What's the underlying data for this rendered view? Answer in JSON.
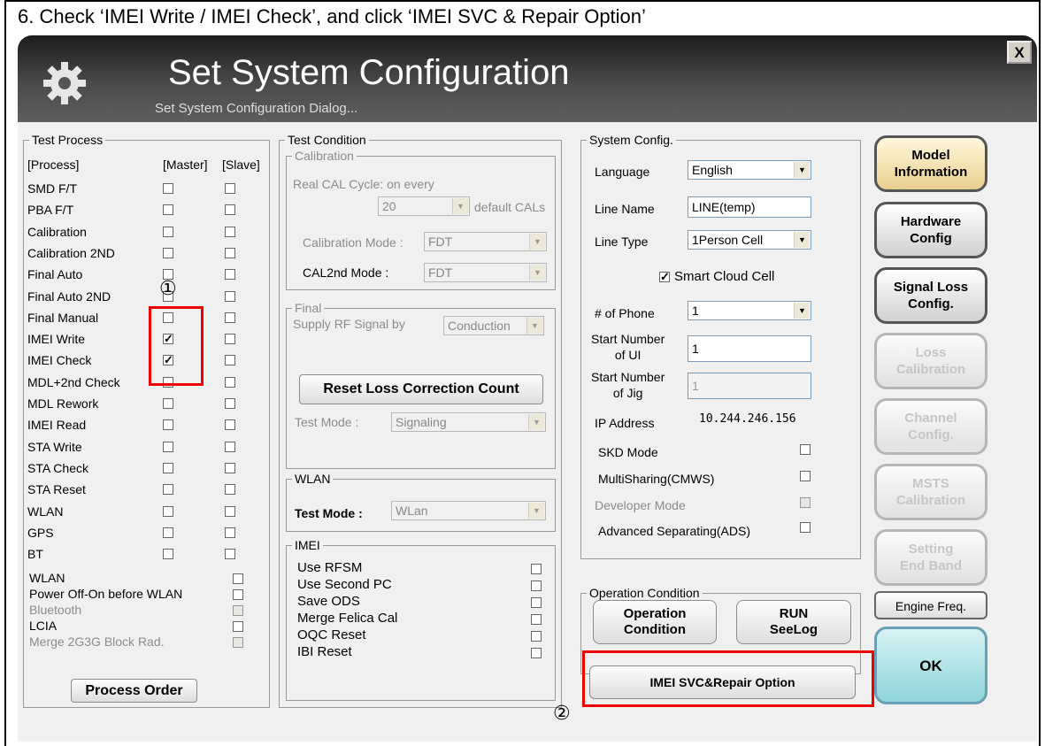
{
  "instruction": "6. Check ‘IMEI Write / IMEI Check’, and click ‘IMEI SVC & Repair Option’",
  "dialog": {
    "title": "Set System Configuration",
    "subtitle": "Set System Configuration Dialog...",
    "close": "X"
  },
  "test_process": {
    "legend": "Test Process",
    "col_process": "[Process]",
    "col_master": "[Master]",
    "col_slave": "[Slave]",
    "items": [
      {
        "label": "SMD F/T",
        "master": false,
        "slave": false
      },
      {
        "label": "PBA F/T",
        "master": false,
        "slave": false
      },
      {
        "label": "Calibration",
        "master": false,
        "slave": false
      },
      {
        "label": "Calibration 2ND",
        "master": false,
        "slave": false
      },
      {
        "label": "Final Auto",
        "master": false,
        "slave": false
      },
      {
        "label": "Final Auto 2ND",
        "master": false,
        "slave": false
      },
      {
        "label": "Final Manual",
        "master": false,
        "slave": false
      },
      {
        "label": "IMEI Write",
        "master": true,
        "slave": false
      },
      {
        "label": "IMEI Check",
        "master": true,
        "slave": false
      },
      {
        "label": "MDL+2nd Check",
        "master": false,
        "slave": false
      },
      {
        "label": "MDL Rework",
        "master": false,
        "slave": false
      },
      {
        "label": "IMEI Read",
        "master": false,
        "slave": false
      },
      {
        "label": "STA Write",
        "master": false,
        "slave": false
      },
      {
        "label": "STA Check",
        "master": false,
        "slave": false
      },
      {
        "label": "STA Reset",
        "master": false,
        "slave": false
      },
      {
        "label": "WLAN",
        "master": false,
        "slave": false
      },
      {
        "label": "GPS",
        "master": false,
        "slave": false
      },
      {
        "label": "BT",
        "master": false,
        "slave": false
      }
    ],
    "options": [
      {
        "label": "WLAN",
        "disabled": false
      },
      {
        "label": "Power Off-On before WLAN",
        "disabled": false
      },
      {
        "label": "Bluetooth",
        "disabled": true
      },
      {
        "label": "LCIA",
        "disabled": false
      },
      {
        "label": "Merge 2G3G Block Rad.",
        "disabled": true
      }
    ],
    "process_order_button": "Process Order"
  },
  "test_condition": {
    "legend": "Test Condition",
    "calibration": {
      "legend": "Calibration",
      "cycle_label": "Real CAL Cycle: on every",
      "cycle_value": "20",
      "cycle_suffix": "default CALs",
      "mode_label": "Calibration Mode :",
      "mode_value": "FDT",
      "cal2_label": "CAL2nd Mode :",
      "cal2_value": "FDT"
    },
    "final": {
      "legend": "Final",
      "supply_label": "Supply RF Signal by",
      "supply_value": "Conduction",
      "reset_button": "Reset Loss Correction Count",
      "test_mode_label": "Test Mode :",
      "test_mode_value": "Signaling"
    },
    "wlan": {
      "legend": "WLAN",
      "test_mode_label": "Test Mode :",
      "test_mode_value": "WLan"
    },
    "imei": {
      "legend": "IMEI",
      "options": [
        "Use RFSM",
        "Use Second PC",
        "Save ODS",
        "Merge Felica Cal",
        "OQC Reset",
        "IBI Reset"
      ]
    }
  },
  "system_config": {
    "legend": "System Config.",
    "language_label": "Language",
    "language_value": "English",
    "line_name_label": "Line Name",
    "line_name_value": "LINE(temp)",
    "line_type_label": "Line Type",
    "line_type_value": "1Person Cell",
    "smart_cloud_label": "Smart Cloud Cell",
    "phone_count_label": "# of Phone",
    "phone_count_value": "1",
    "start_ui_label_1": "Start Number",
    "start_ui_label_2": "of UI",
    "start_ui_value": "1",
    "start_jig_label_1": "Start Number",
    "start_jig_label_2": "of Jig",
    "start_jig_value": "1",
    "ip_label": "IP Address",
    "ip_value": "10.244.246.156",
    "skd_label": "SKD Mode",
    "multisharing_label": "MultiSharing(CMWS)",
    "developer_label": "Developer Mode",
    "ads_label": "Advanced Separating(ADS)"
  },
  "operation_condition": {
    "legend": "Operation Condition",
    "op_button_1": "Operation",
    "op_button_2": "Condition",
    "run_button_1": "RUN",
    "run_button_2": "SeeLog",
    "imei_svc_button": "IMEI SVC&Repair Option"
  },
  "side_buttons": {
    "model_1": "Model",
    "model_2": "Information",
    "hardware_1": "Hardware",
    "hardware_2": "Config",
    "signal_1": "Signal Loss",
    "signal_2": "Config.",
    "loss_1": "Loss",
    "loss_2": "Calibration",
    "channel_1": "Channel",
    "channel_2": "Config.",
    "msts_1": "MSTS",
    "msts_2": "Calibration",
    "setting_1": "Setting",
    "setting_2": "End Band",
    "engine": "Engine Freq.",
    "ok": "OK"
  },
  "annotations": {
    "marker_1": "①",
    "marker_2": "②"
  },
  "colors": {
    "highlight": "#e00000",
    "titlebar": "#2e2e2e",
    "ok_button": "#8dd5da",
    "model_button": "#e8cf8e"
  }
}
